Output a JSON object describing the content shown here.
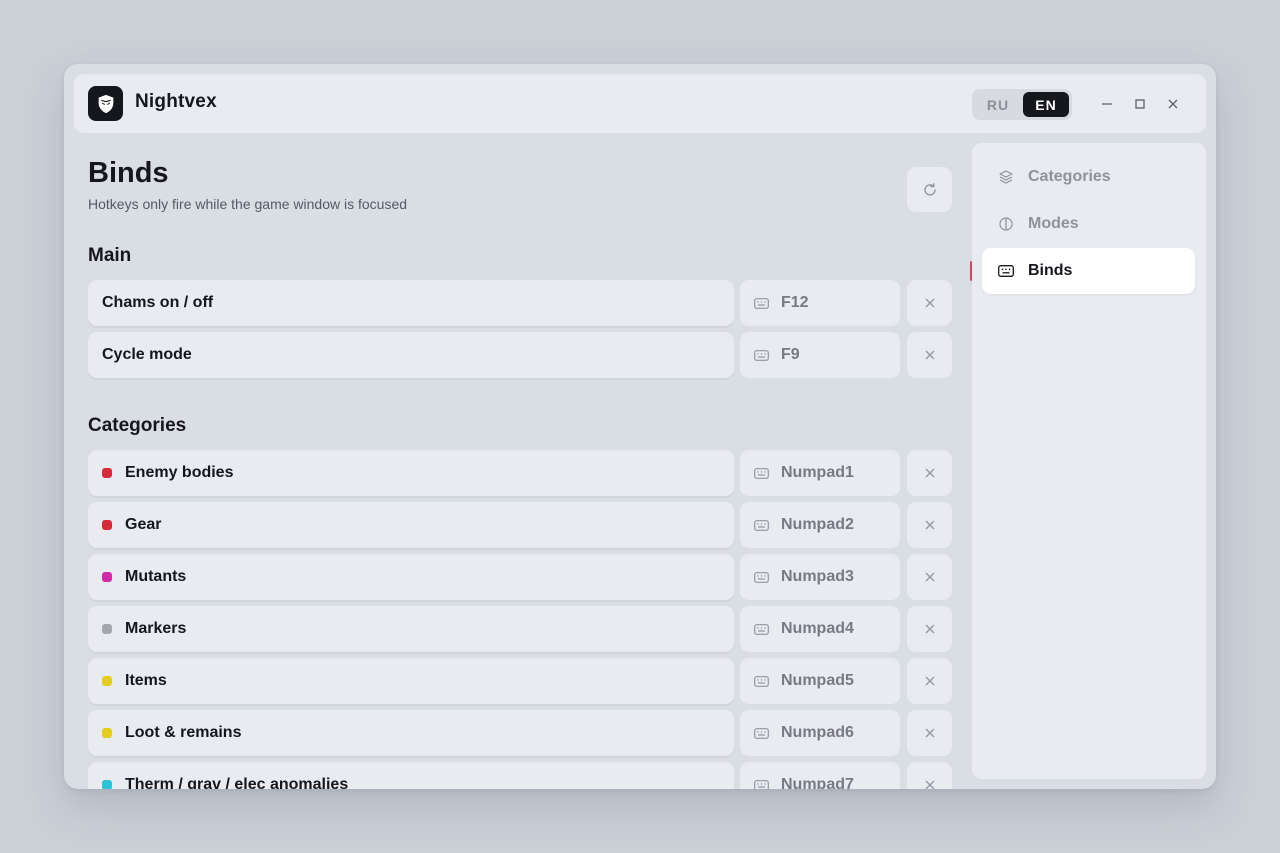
{
  "app": {
    "title": "Nightvex"
  },
  "lang": {
    "ru": "RU",
    "en": "EN",
    "active": "EN"
  },
  "page": {
    "title": "Binds",
    "subtitle": "Hotkeys only fire while the game window is focused"
  },
  "sections": {
    "main": {
      "title": "Main",
      "rows": [
        {
          "name": "Chams on / off",
          "key": "F12"
        },
        {
          "name": "Cycle mode",
          "key": "F9"
        }
      ]
    },
    "categories": {
      "title": "Categories",
      "rows": [
        {
          "name": "Enemy bodies",
          "key": "Numpad1",
          "color": "#d42a3a"
        },
        {
          "name": "Gear",
          "key": "Numpad2",
          "color": "#d42a3a"
        },
        {
          "name": "Mutants",
          "key": "Numpad3",
          "color": "#d12aa6"
        },
        {
          "name": "Markers",
          "key": "Numpad4",
          "color": "#a3a6ab"
        },
        {
          "name": "Items",
          "key": "Numpad5",
          "color": "#e3cd21"
        },
        {
          "name": "Loot & remains",
          "key": "Numpad6",
          "color": "#e3cd21"
        },
        {
          "name": "Therm / grav / elec anomalies",
          "key": "Numpad7",
          "color": "#2cc3d6"
        }
      ]
    }
  },
  "sidebar": {
    "items": [
      {
        "label": "Categories",
        "icon": "layers-icon"
      },
      {
        "label": "Modes",
        "icon": "half-circle-icon"
      },
      {
        "label": "Binds",
        "icon": "keyboard-icon",
        "active": true
      }
    ]
  },
  "colors": {
    "accent": "#d1495b",
    "dark": "#15171c",
    "panel": "#e8ebef",
    "background": "#d9dee5"
  }
}
